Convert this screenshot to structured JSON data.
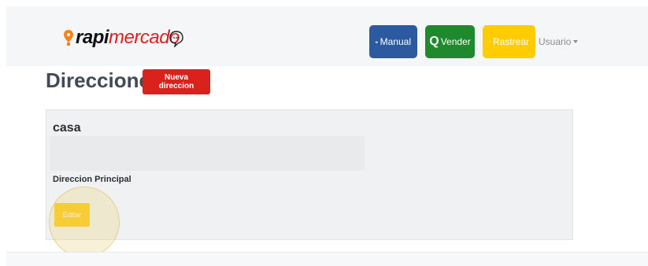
{
  "brand": {
    "name_bold": "rapi",
    "name_light": "mercado",
    "colors": {
      "dark": "#0f0f0f",
      "accent": "#e01e1e",
      "pin": "#f58220"
    }
  },
  "navbar": {
    "chat_icon": "chat-bubble-icon",
    "buttons": [
      {
        "label": "Manual",
        "icon": "book-icon",
        "color": "#2c5aa0"
      },
      {
        "label": "Vender",
        "icon": "q-icon",
        "icon_text": "Q",
        "color": "#1f8a2d"
      },
      {
        "label": "Rastrear",
        "icon": "location-arrow-icon",
        "color": "#ffcc00"
      }
    ],
    "user_menu": "Usuario"
  },
  "page": {
    "title": "Direcciones",
    "new_button": "Nueva direccion"
  },
  "address_card": {
    "title": "casa",
    "address_value": "",
    "label": "Direccion Principal",
    "edit_button": "Editar"
  }
}
